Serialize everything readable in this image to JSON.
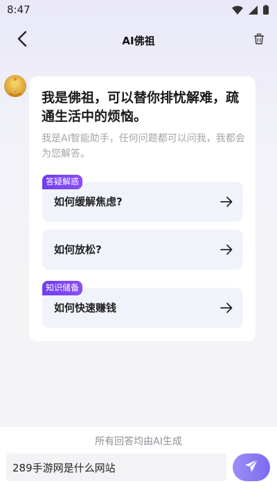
{
  "status_bar": {
    "time": "8:47",
    "icons": [
      "wifi-icon",
      "signal-icon",
      "battery-icon"
    ]
  },
  "header": {
    "title": "AI佛祖",
    "back_icon": "chevron-left-icon",
    "clear_icon": "trash-icon"
  },
  "greeting": {
    "title": "我是佛祖，可以替你排忧解难，疏通生活中的烦恼。",
    "subtitle": "我是AI智能助手，任何问题都可以问我，我都会为您解答。"
  },
  "questions": [
    {
      "tag": "答疑解惑",
      "text": "如何缓解焦虑?"
    },
    {
      "tag": "",
      "text": "如何放松?"
    },
    {
      "tag": "知识储备",
      "text": "如何快速赚钱"
    }
  ],
  "footer": {
    "note": "所有回答均由AI生成",
    "input_value": "289手游网是什么网站",
    "send_icon": "paper-plane-icon"
  },
  "colors": {
    "accent": "#7a4df2",
    "send_button": "#8a7cf3",
    "card_bg": "#ffffff",
    "question_bg": "#f1f3fb"
  }
}
